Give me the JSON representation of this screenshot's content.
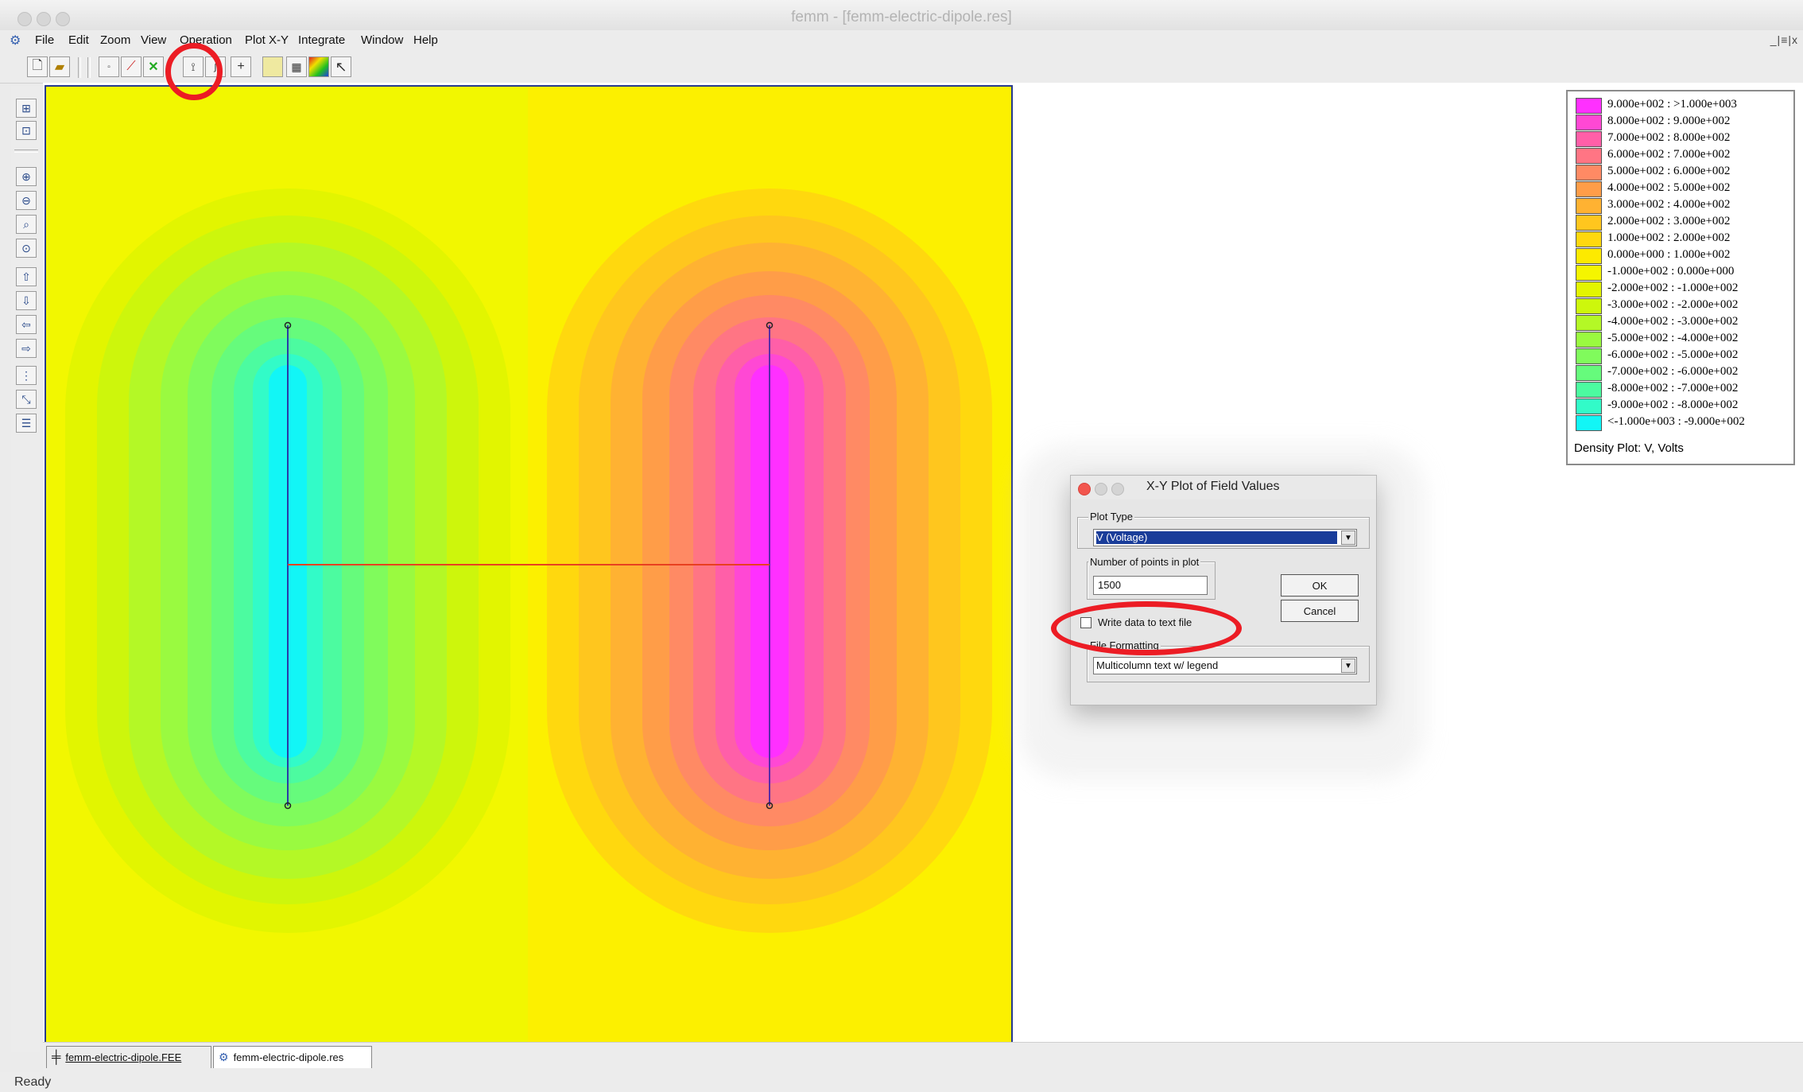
{
  "window": {
    "title": "femm - [femm-electric-dipole.res]"
  },
  "menu": {
    "items": [
      {
        "label": "File",
        "key": "file"
      },
      {
        "label": "Edit",
        "key": "edit"
      },
      {
        "label": "Zoom",
        "key": "zoom"
      },
      {
        "label": "View",
        "key": "view"
      },
      {
        "label": "Operation",
        "key": "operation"
      },
      {
        "label": "Plot X-Y",
        "key": "plot-xy"
      },
      {
        "label": "Integrate",
        "key": "integrate"
      },
      {
        "label": "Window",
        "key": "window"
      },
      {
        "label": "Help",
        "key": "help"
      }
    ],
    "mdi_buttons": "_|≡|x"
  },
  "legend": {
    "rows": [
      {
        "label": "9.000e+002 : >1.000e+003",
        "color": "#ff30ff"
      },
      {
        "label": "8.000e+002 : 9.000e+002",
        "color": "#ff48d4"
      },
      {
        "label": "7.000e+002 : 8.000e+002",
        "color": "#ff5fa8"
      },
      {
        "label": "6.000e+002 : 7.000e+002",
        "color": "#ff7584"
      },
      {
        "label": "5.000e+002 : 6.000e+002",
        "color": "#ff8a64"
      },
      {
        "label": "4.000e+002 : 5.000e+002",
        "color": "#ff9d48"
      },
      {
        "label": "3.000e+002 : 4.000e+002",
        "color": "#ffb232"
      },
      {
        "label": "2.000e+002 : 3.000e+002",
        "color": "#ffc61e"
      },
      {
        "label": "1.000e+002 : 2.000e+002",
        "color": "#ffd80e"
      },
      {
        "label": "0.000e+000 : 1.000e+002",
        "color": "#fdea00"
      },
      {
        "label": "-1.000e+002 : 0.000e+000",
        "color": "#f5f500"
      },
      {
        "label": "-2.000e+002 : -1.000e+002",
        "color": "#e3f500"
      },
      {
        "label": "-3.000e+002 : -2.000e+002",
        "color": "#cdf70c"
      },
      {
        "label": "-4.000e+002 : -3.000e+002",
        "color": "#b4f826"
      },
      {
        "label": "-5.000e+002 : -4.000e+002",
        "color": "#9afa40"
      },
      {
        "label": "-6.000e+002 : -5.000e+002",
        "color": "#80fb5c"
      },
      {
        "label": "-7.000e+002 : -6.000e+002",
        "color": "#66fb7c"
      },
      {
        "label": "-8.000e+002 : -7.000e+002",
        "color": "#4cfba0"
      },
      {
        "label": "-9.000e+002 : -8.000e+002",
        "color": "#32fbc8"
      },
      {
        "label": "<-1.000e+003 : -9.000e+002",
        "color": "#12f6f6"
      }
    ],
    "caption": "Density Plot: V, Volts"
  },
  "dialog": {
    "title": "X-Y Plot of Field Values",
    "plot_type_label": "Plot Type",
    "plot_type_value": "V    (Voltage)",
    "points_label": "Number of points in plot",
    "points_value": "1500",
    "ok_label": "OK",
    "cancel_label": "Cancel",
    "write_checkbox_label": "Write  data to text file",
    "write_checked": false,
    "file_format_label": "File Formatting",
    "file_format_value": "Multicolumn text w/ legend"
  },
  "tabs": [
    {
      "label": "femm-electric-dipole.FEE",
      "icon": "electrostatic-preprocessor-icon"
    },
    {
      "label": "femm-electric-dipole.res",
      "icon": "femm-postprocessor-icon"
    }
  ],
  "status": {
    "text": "Ready"
  }
}
